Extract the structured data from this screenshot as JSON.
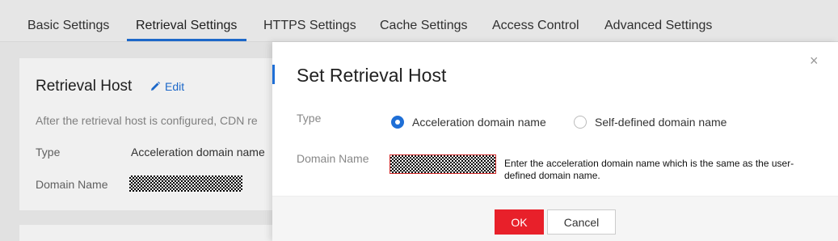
{
  "tabs": [
    {
      "label": "Basic Settings"
    },
    {
      "label": "Retrieval Settings"
    },
    {
      "label": "HTTPS Settings"
    },
    {
      "label": "Cache Settings"
    },
    {
      "label": "Access Control"
    },
    {
      "label": "Advanced Settings"
    }
  ],
  "active_tab": "Retrieval Settings",
  "card": {
    "title": "Retrieval Host",
    "edit_label": "Edit",
    "description": "After the retrieval host is configured, CDN re",
    "type_label": "Type",
    "type_value": "Acceleration domain name",
    "domain_label": "Domain Name"
  },
  "modal": {
    "title": "Set Retrieval Host",
    "close_glyph": "×",
    "type_label": "Type",
    "options": [
      {
        "label": "Acceleration domain name",
        "checked": true
      },
      {
        "label": "Self-defined domain name",
        "checked": false
      }
    ],
    "domain_label": "Domain Name",
    "hint": "Enter the acceleration domain name which is the same as the user-defined domain name.",
    "ok_label": "OK",
    "cancel_label": "Cancel"
  },
  "colors": {
    "accent": "#1f6fd6",
    "ok_button": "#e8202a",
    "input_error_border": "#d12b2b"
  },
  "icons": {
    "edit": "pencil-icon",
    "close": "close-icon"
  }
}
